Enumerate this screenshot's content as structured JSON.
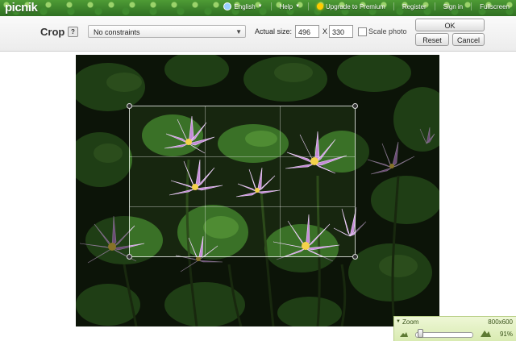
{
  "header": {
    "logo": "picnik",
    "nav": {
      "english": "English",
      "help": "Help",
      "upgrade": "Upgrade to Premium",
      "register": "Register",
      "sign_in": "Sign in",
      "fullscreen": "Fullscreen"
    }
  },
  "toolbar": {
    "title": "Crop",
    "help_glyph": "?",
    "constraint_selected": "No constraints",
    "actual_size_label": "Actual size:",
    "width": "496",
    "x_label": "X",
    "height": "330",
    "scale_photo_label": "Scale photo",
    "ok_label": "OK",
    "reset_label": "Reset",
    "cancel_label": "Cancel"
  },
  "zoom": {
    "label": "Zoom",
    "dimensions": "800x600",
    "percent": "91%",
    "slider_fraction": 0.04
  },
  "icons": {
    "globe": "globe-icon",
    "sun": "sun-icon",
    "zoom_out": "mountain-small-icon",
    "zoom_in": "mountain-large-icon"
  },
  "colors": {
    "brand_green": "#2f6f22",
    "zoom_panel": "#d9ebb2"
  }
}
